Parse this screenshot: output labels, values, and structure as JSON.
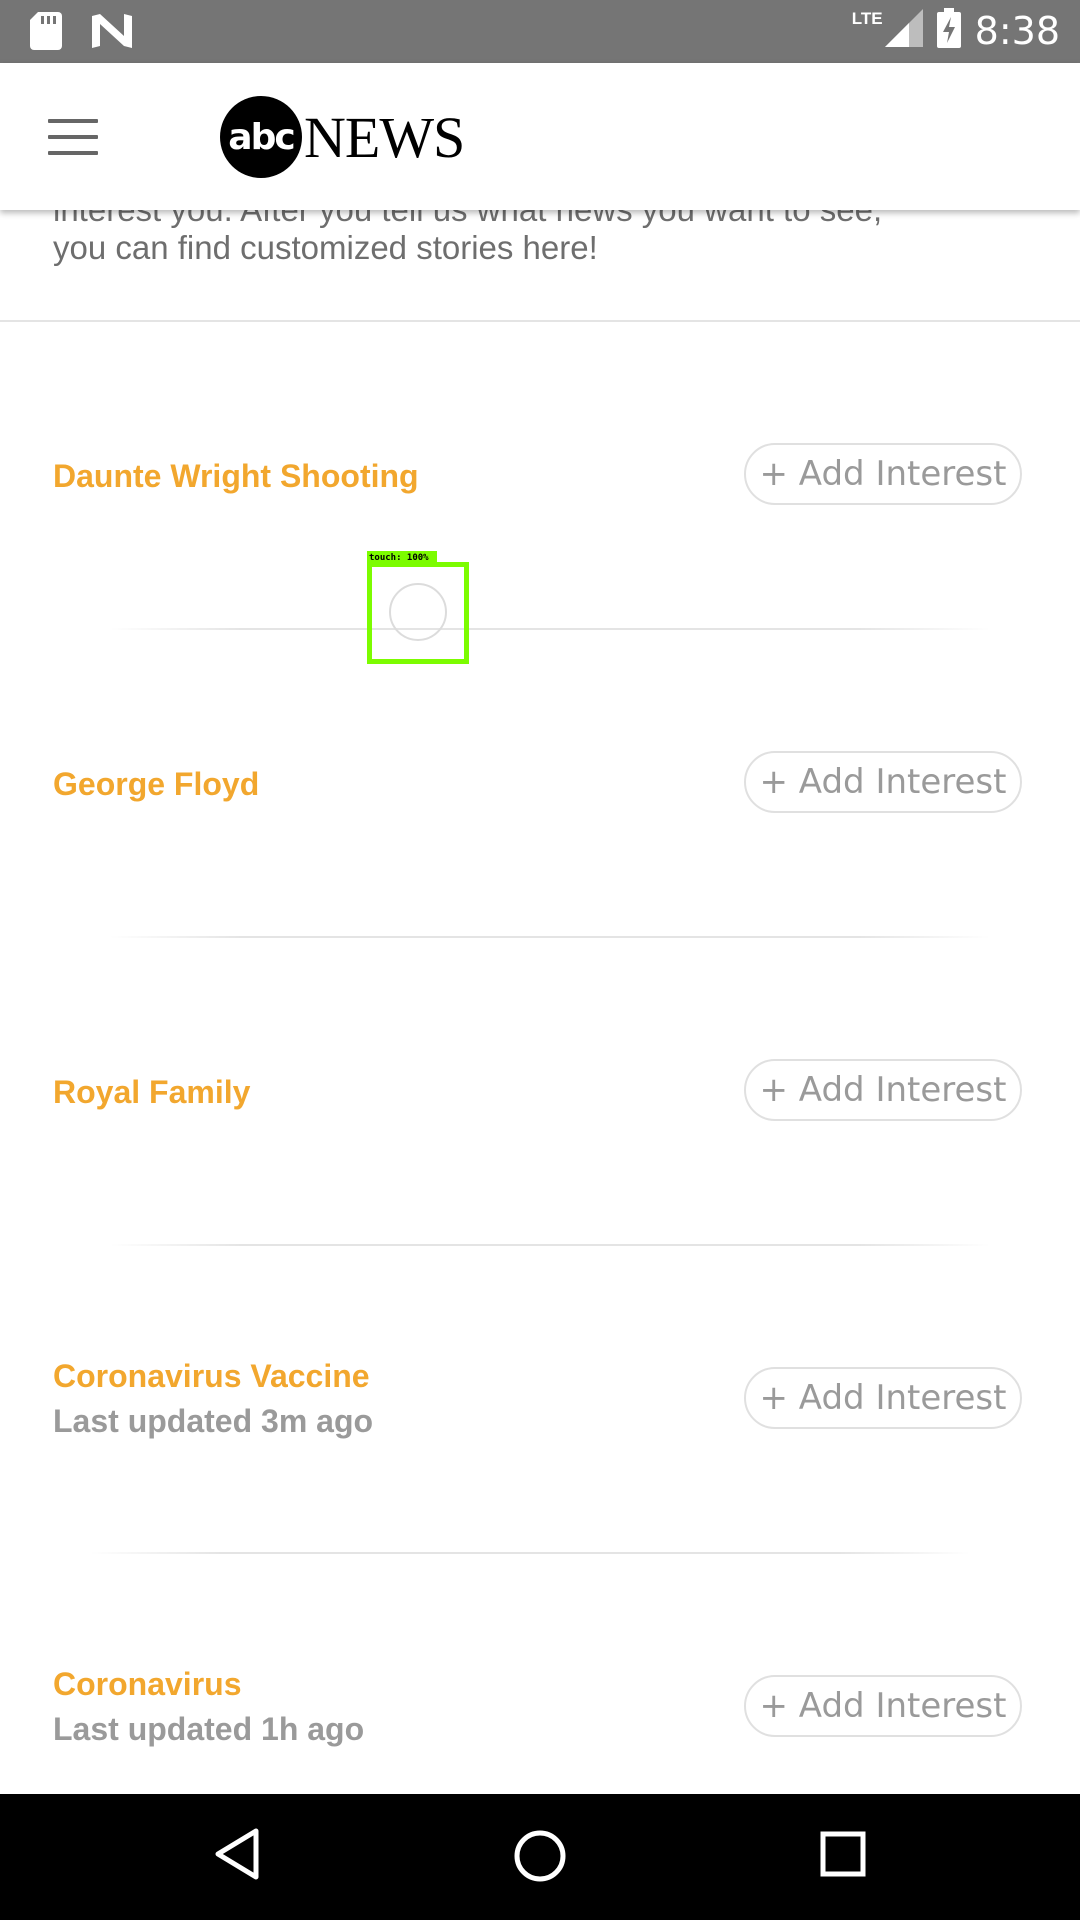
{
  "status_bar": {
    "network": "LTE",
    "time": "8:38",
    "icons": [
      "sd-card-icon",
      "n-icon",
      "signal-icon",
      "battery-charging-icon"
    ]
  },
  "header": {
    "logo_abc": "abc",
    "logo_news": "NEWS"
  },
  "intro": {
    "line1": "interest you. After you tell us what news you want to see,",
    "line2": "you can find customized stories here!"
  },
  "topics": [
    {
      "title": "Daunte Wright Shooting",
      "button": "+ Add Interest"
    },
    {
      "title": "George Floyd",
      "button": "+ Add Interest"
    },
    {
      "title": "Royal Family",
      "button": "+ Add Interest"
    },
    {
      "title": "Coronavirus Vaccine",
      "updated": "Last updated 3m ago",
      "button": "+ Add Interest"
    },
    {
      "title": "Coronavirus",
      "updated": "Last updated 1h ago",
      "button": "+ Add Interest"
    }
  ],
  "touch_overlay": {
    "label": "touch: 100%"
  },
  "nav_bar": {
    "icons": [
      "back-icon",
      "home-icon",
      "recents-icon"
    ]
  },
  "colors": {
    "accent": "#f2a72e",
    "status_bar": "#757575",
    "muted_text": "#9a9a9a"
  }
}
